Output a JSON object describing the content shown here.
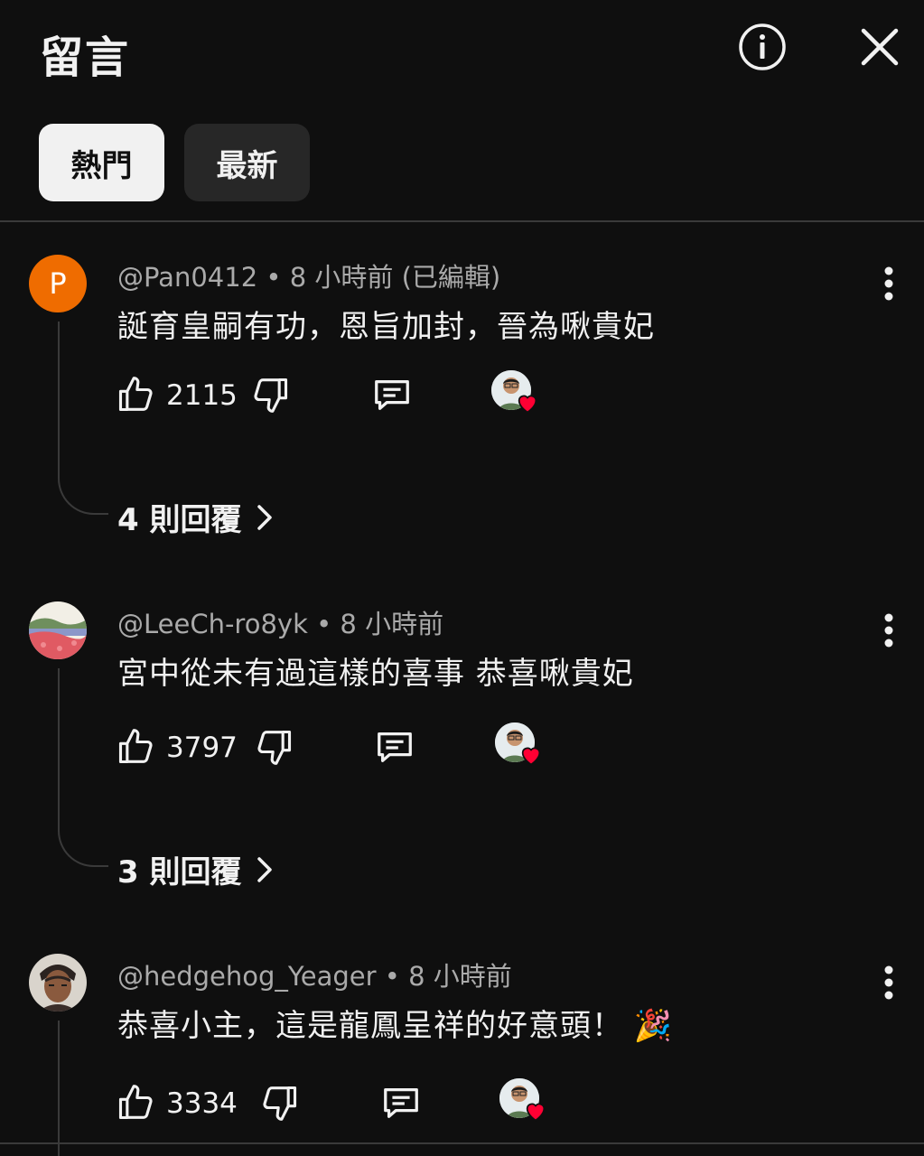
{
  "header": {
    "title": "留言",
    "info_icon": "info-icon",
    "close_icon": "close-icon"
  },
  "chips": [
    {
      "label": "熱門",
      "selected": true
    },
    {
      "label": "最新",
      "selected": false
    }
  ],
  "comments": [
    {
      "author": "@Pan0412",
      "time": "8 小時前",
      "edited": "(已編輯)",
      "text": "誕育皇嗣有功，恩旨加封，晉為啾貴妃",
      "likes": "2115",
      "replies_label": "4 則回覆",
      "avatar_letter": "P",
      "avatar_color": "#ef6c00",
      "creator_heart": true
    },
    {
      "author": "@LeeCh-ro8yk",
      "time": "8 小時前",
      "text": "宮中從未有過這樣的喜事 恭喜啾貴妃",
      "likes": "3797",
      "replies_label": "3 則回覆",
      "creator_heart": true
    },
    {
      "author": "@hedgehog_Yeager",
      "time": "8 小時前",
      "text": "恭喜小主，這是龍鳳呈祥的好意頭！",
      "emoji": "🎉",
      "likes": "3334",
      "creator_heart": true
    }
  ],
  "separator": "•",
  "colors": {
    "background": "#0f0f0f",
    "chip_active": "#f1f1f1",
    "chip_inactive": "#272727",
    "meta": "#aaaaaa",
    "heart": "#ff0033"
  }
}
